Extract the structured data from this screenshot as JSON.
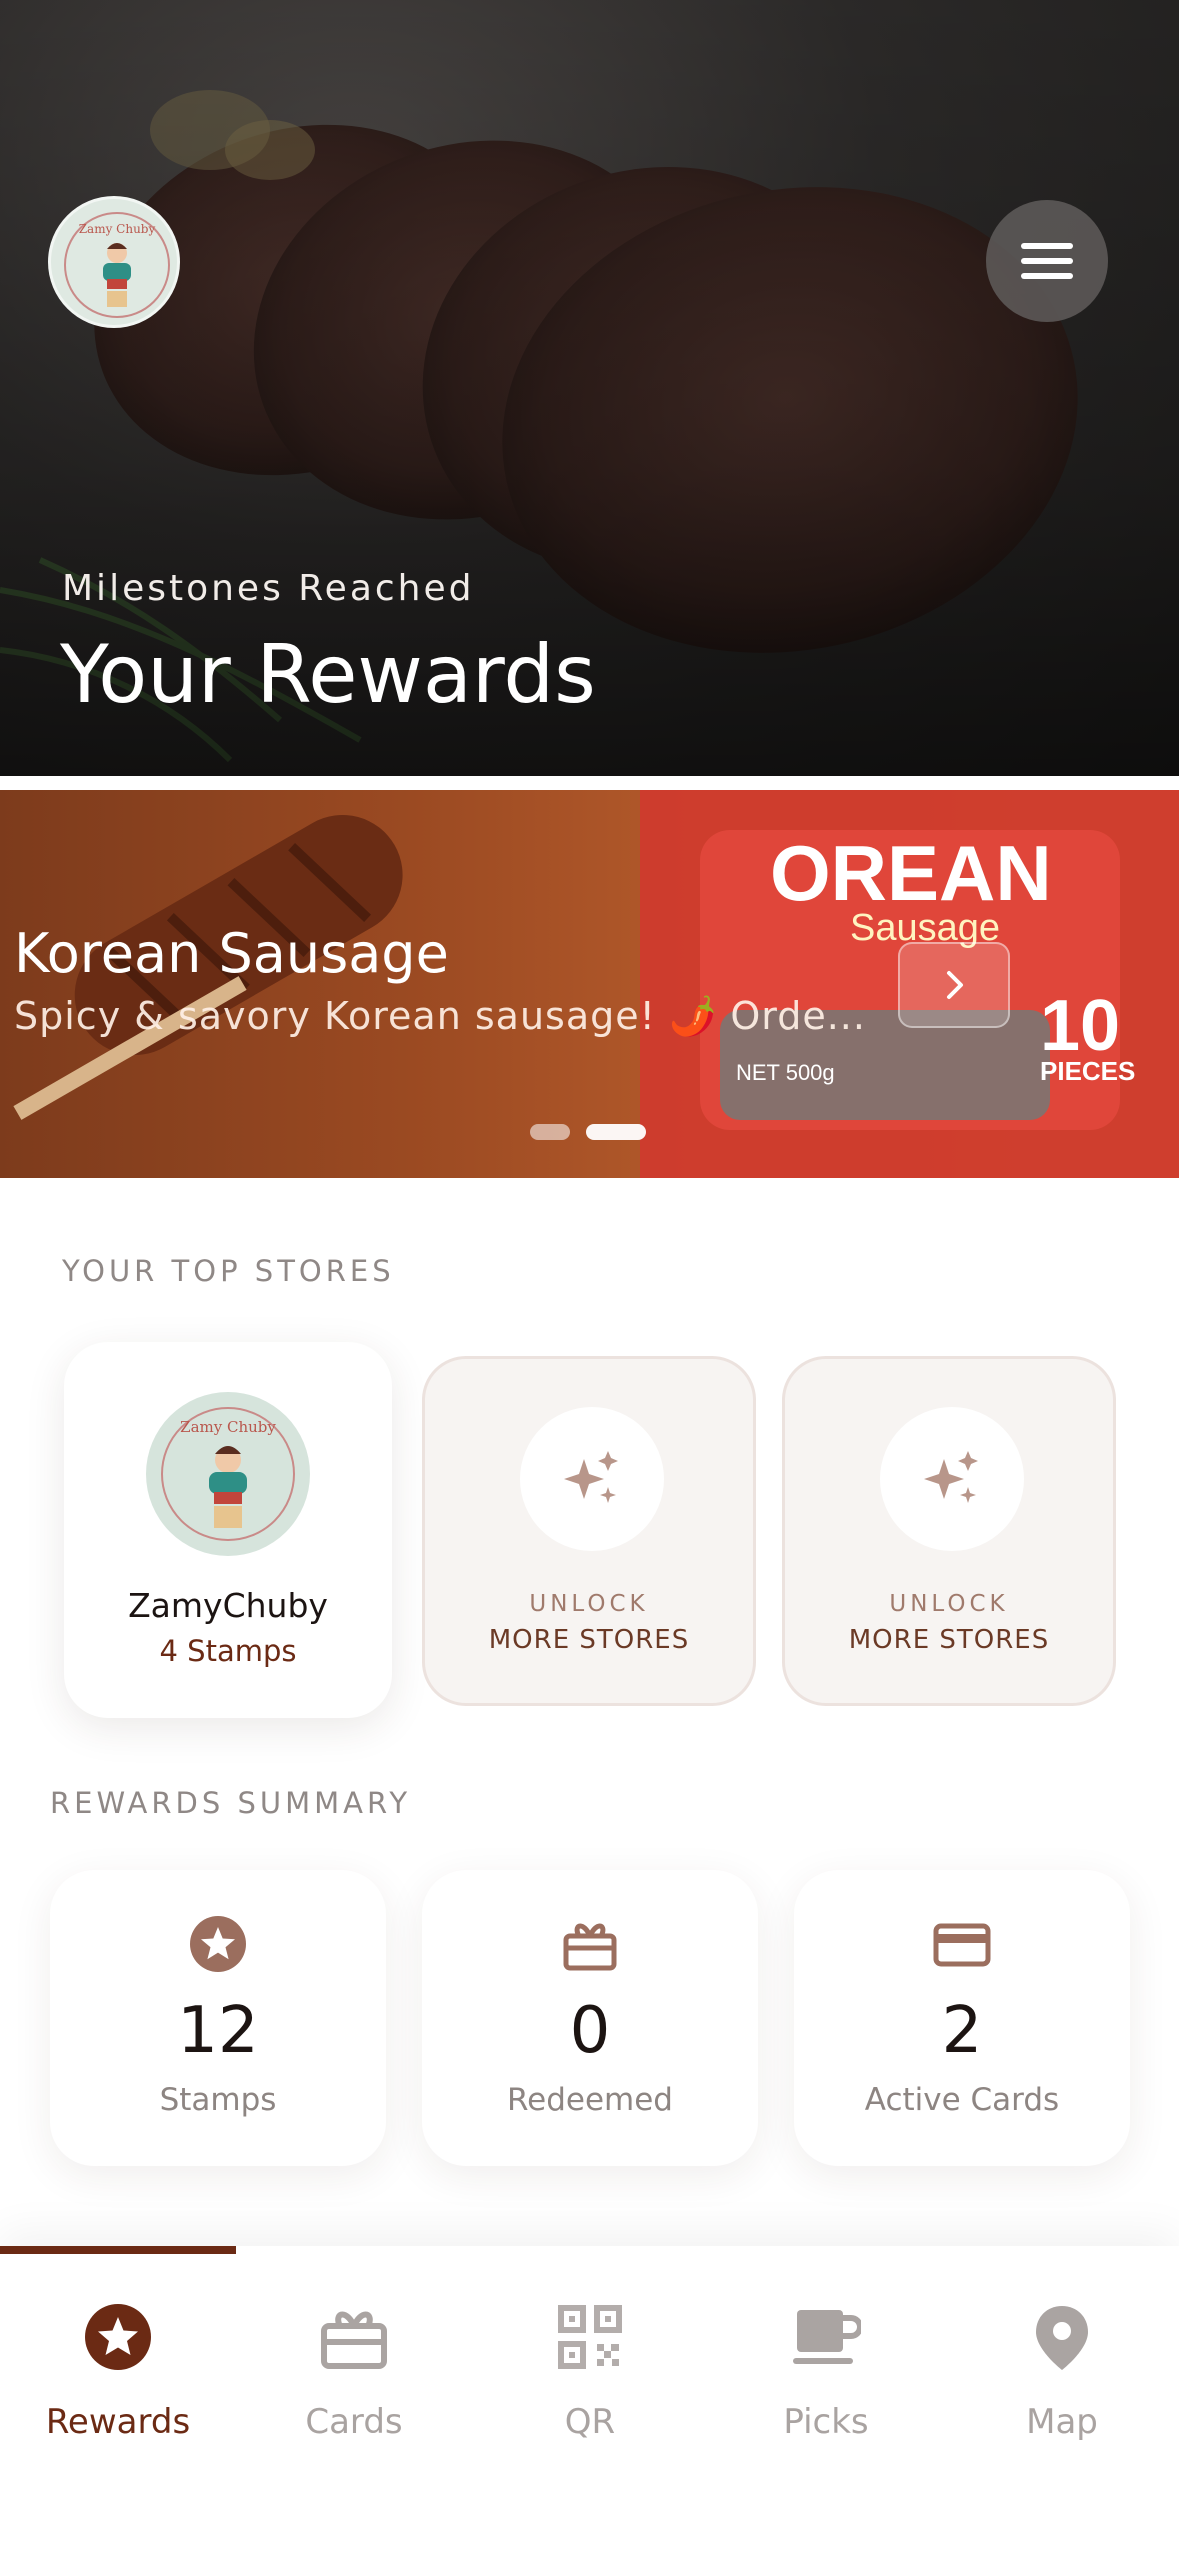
{
  "hero": {
    "subtitle": "Milestones Reached",
    "title": "Your Rewards"
  },
  "promo": {
    "title": "Korean Sausage",
    "description": "Spicy & savory Korean sausage! 🌶️ Orde...",
    "slide_count": 2,
    "active_slide": 2,
    "package_text": [
      "OREAN",
      "Sausage",
      "10",
      "PIECES",
      "NET 500g"
    ]
  },
  "top_stores": {
    "label": "YOUR TOP STORES",
    "stores": [
      {
        "name": "ZamyChuby",
        "stamps": "4 Stamps",
        "logo_text": "Zamy Chuby"
      }
    ],
    "locked": [
      {
        "line1": "UNLOCK",
        "line2": "MORE STORES"
      },
      {
        "line1": "UNLOCK",
        "line2": "MORE STORES"
      }
    ]
  },
  "summary": {
    "label": "REWARDS SUMMARY",
    "items": [
      {
        "icon": "star-icon",
        "value": "12",
        "label": "Stamps"
      },
      {
        "icon": "gift-icon",
        "value": "0",
        "label": "Redeemed"
      },
      {
        "icon": "credit-card-icon",
        "value": "2",
        "label": "Active Cards"
      }
    ]
  },
  "tabbar": {
    "active": "Rewards",
    "tabs": [
      {
        "label": "Rewards",
        "icon": "star-badge-icon"
      },
      {
        "label": "Cards",
        "icon": "gift-card-icon"
      },
      {
        "label": "QR",
        "icon": "qr-code-icon"
      },
      {
        "label": "Picks",
        "icon": "coffee-cup-icon"
      },
      {
        "label": "Map",
        "icon": "map-pin-icon"
      }
    ]
  },
  "colors": {
    "accent": "#6b2a14",
    "icon_brown": "#9b6e5e",
    "muted": "#a9a3a1"
  }
}
